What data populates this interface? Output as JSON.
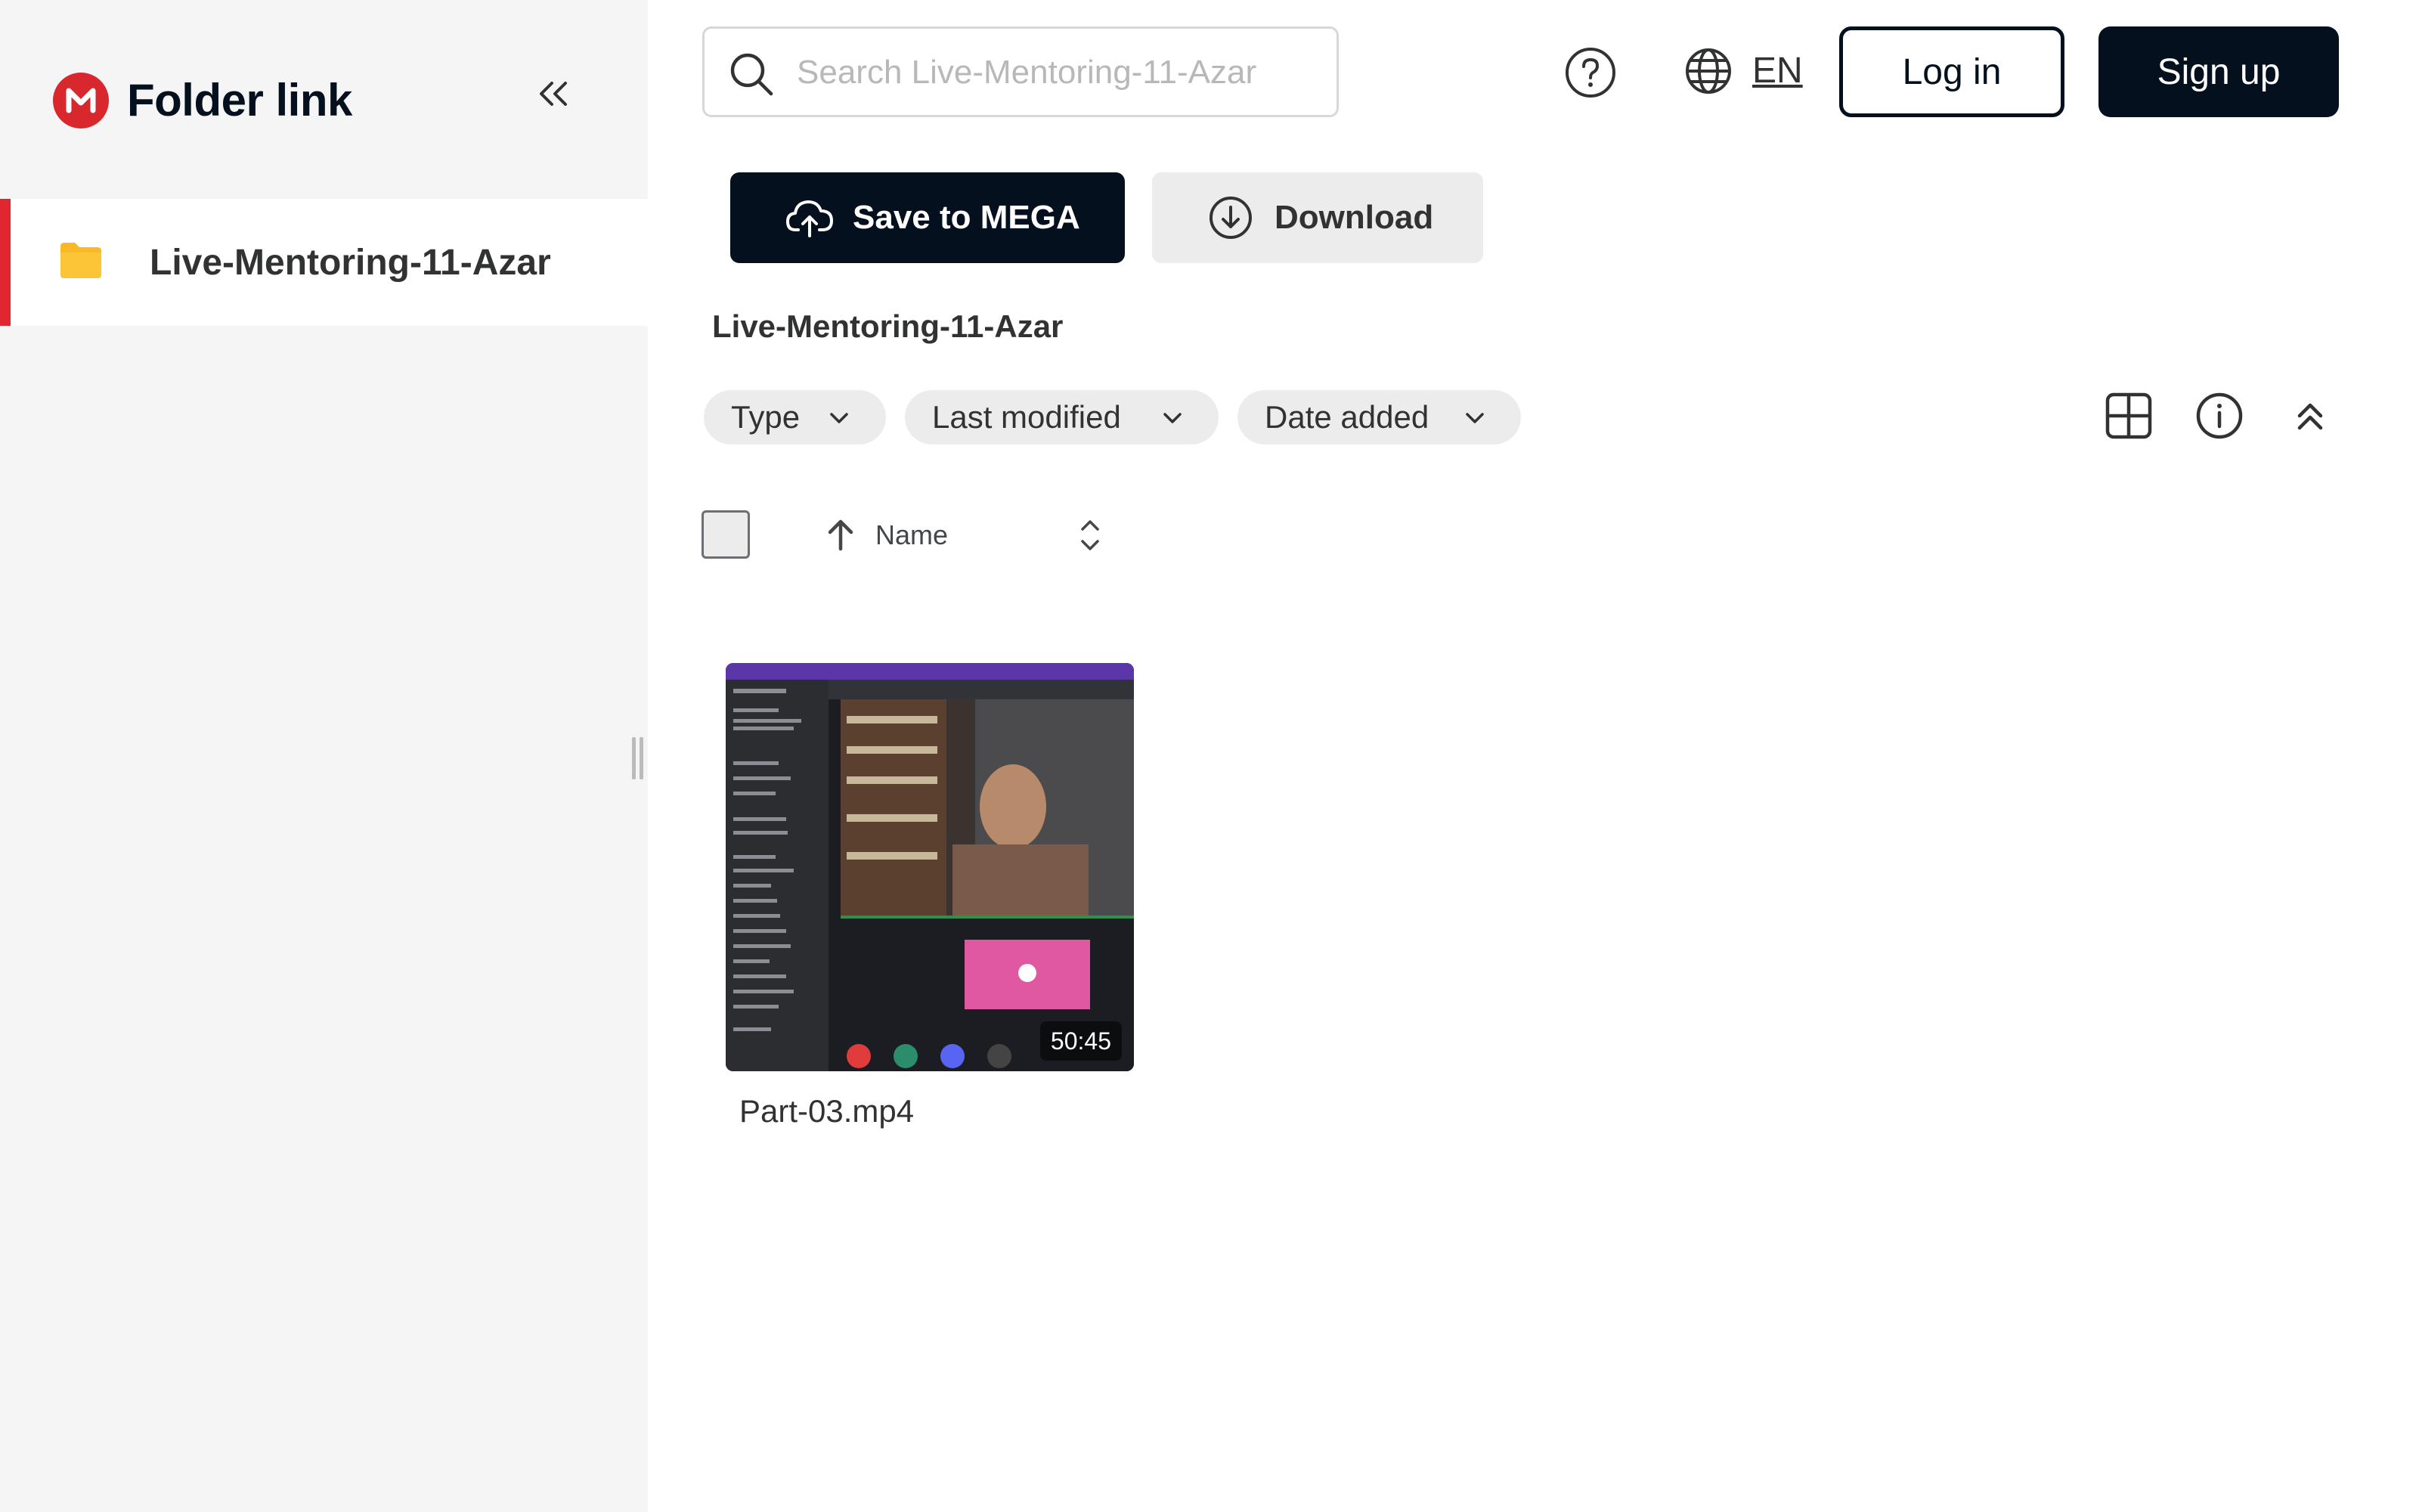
{
  "sidebar": {
    "title": "Folder link",
    "items": [
      {
        "label": "Live-Mentoring-11-Azar",
        "selected": true
      }
    ]
  },
  "header": {
    "search_placeholder": "Search Live-Mentoring-11-Azar",
    "language": "EN",
    "login_label": "Log in",
    "signup_label": "Sign up"
  },
  "actions": {
    "save_label": "Save to MEGA",
    "download_label": "Download"
  },
  "breadcrumb": "Live-Mentoring-11-Azar",
  "filters": {
    "type_label": "Type",
    "modified_label": "Last modified",
    "added_label": "Date added"
  },
  "table": {
    "name_header": "Name",
    "sort_direction": "ascending"
  },
  "files": [
    {
      "name": "Part-03.mp4",
      "duration": "50:45",
      "kind": "video"
    }
  ],
  "colors": {
    "brand_red": "#d9272e",
    "primary_dark": "#04101e",
    "sidebar_bg": "#f5f5f5",
    "chip_bg": "#ececec",
    "folder_yellow": "#f9b825"
  },
  "icons": [
    "mega-logo-icon",
    "chevrons-left-icon",
    "folder-icon",
    "search-icon",
    "help-icon",
    "globe-icon",
    "cloud-upload-icon",
    "download-icon",
    "chevron-down-icon",
    "grid-view-icon",
    "info-icon",
    "chevrons-up-icon",
    "arrow-up-icon",
    "sort-toggle-icon"
  ]
}
